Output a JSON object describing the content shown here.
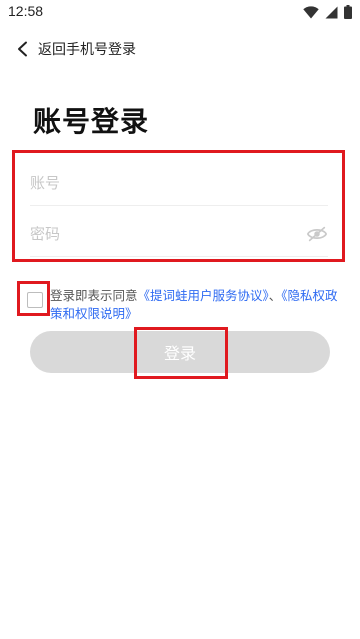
{
  "status_bar": {
    "time": "12:58",
    "icons": [
      "wifi-icon",
      "cellular-signal-icon",
      "battery-icon"
    ]
  },
  "header": {
    "back_label": "返回手机号登录",
    "back_icon": "chevron-left-icon"
  },
  "title": "账号登录",
  "form": {
    "account_placeholder": "账号",
    "account_value": "",
    "password_placeholder": "密码",
    "password_value": "",
    "password_toggle_icon": "eye-off-icon"
  },
  "agreement": {
    "checked": false,
    "prefix": "登录即表示同意",
    "user_agreement": "《提词蛙用户服务协议》",
    "separator": "、",
    "privacy_policy": "《隐私权政策和权限说明》"
  },
  "login_button": {
    "label": "登录"
  },
  "colors": {
    "link": "#2f6bf2",
    "button_disabled": "#d9d9d9",
    "highlight_box": "#e0191f",
    "placeholder": "#c7c7c7"
  }
}
